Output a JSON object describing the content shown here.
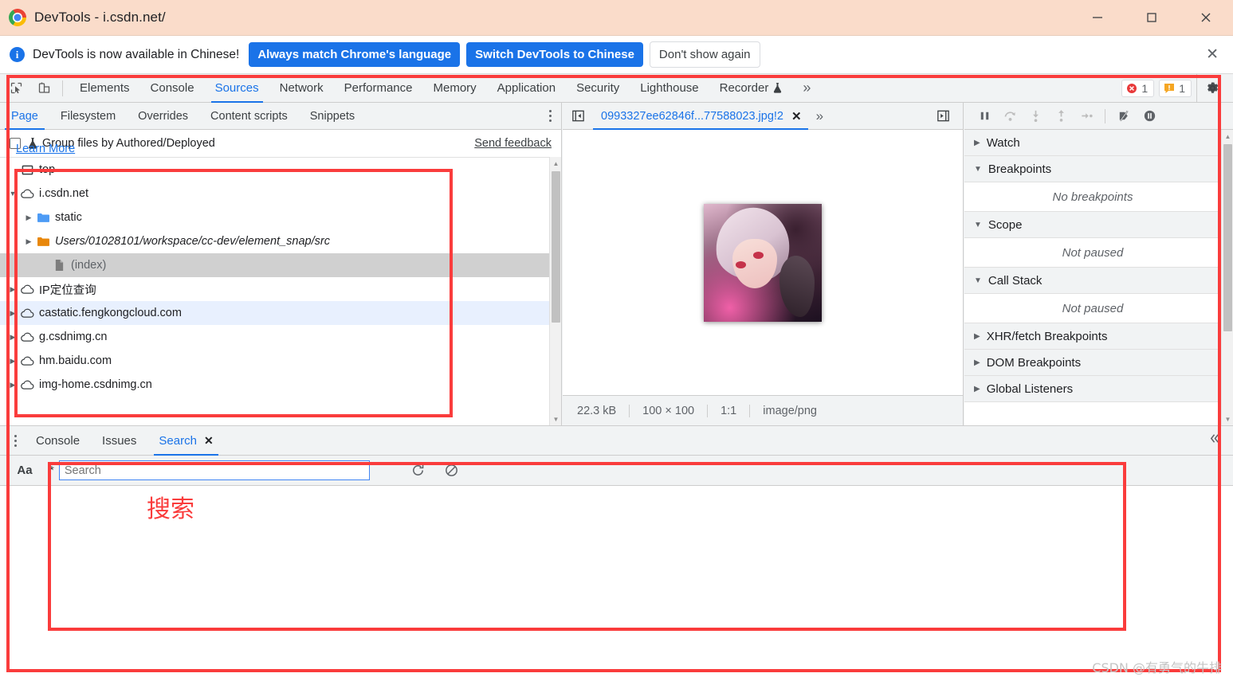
{
  "window": {
    "title": "DevTools - i.csdn.net/",
    "logo_icon": "chrome-logo-icon",
    "minimize_icon": "minimize-icon",
    "maximize_icon": "maximize-icon",
    "close_icon": "close-icon"
  },
  "infobar": {
    "icon": "info-icon",
    "icon_glyph": "i",
    "message": "DevTools is now available in Chinese!",
    "primary_button": "Always match Chrome's language",
    "secondary_button": "Switch DevTools to Chinese",
    "tertiary_button": "Don't show again",
    "close_glyph": "✕",
    "accent_color": "#1a73e8"
  },
  "main_tabs": {
    "inspect_icon": "inspect-element-icon",
    "device_icon": "device-toolbar-icon",
    "items": [
      {
        "label": "Elements",
        "active": false
      },
      {
        "label": "Console",
        "active": false
      },
      {
        "label": "Sources",
        "active": true
      },
      {
        "label": "Network",
        "active": false
      },
      {
        "label": "Performance",
        "active": false
      },
      {
        "label": "Memory",
        "active": false
      },
      {
        "label": "Application",
        "active": false
      },
      {
        "label": "Security",
        "active": false
      },
      {
        "label": "Lighthouse",
        "active": false
      },
      {
        "label": "Recorder",
        "active": false,
        "beaker": true
      }
    ],
    "more_glyph": "»",
    "errors": "1",
    "warnings": "1",
    "error_icon": "error-badge-icon",
    "warning_icon": "warning-badge-icon",
    "settings_icon": "gear-icon"
  },
  "navigator": {
    "tabs": [
      {
        "label": "Page",
        "active": true
      },
      {
        "label": "Filesystem",
        "active": false
      },
      {
        "label": "Overrides",
        "active": false
      },
      {
        "label": "Content scripts",
        "active": false
      },
      {
        "label": "Snippets",
        "active": false
      }
    ],
    "kebab_icon": "more-options-icon",
    "group_checkbox_label": "Group files by Authored/Deployed",
    "group_beaker_icon": "experiment-beaker-icon",
    "send_feedback": "Send feedback",
    "learn_more": "Learn More",
    "tree": [
      {
        "label": "top",
        "icon": "frame-icon",
        "indent": 0,
        "arrow": "none",
        "state": "normal"
      },
      {
        "label": "i.csdn.net",
        "icon": "cloud-icon",
        "indent": 0,
        "arrow": "down",
        "state": "normal"
      },
      {
        "label": "static",
        "icon": "folder-blue-icon",
        "indent": 1,
        "arrow": "right",
        "state": "normal"
      },
      {
        "label": "Users/01028101/workspace/cc-dev/element_snap/src",
        "icon": "folder-orange-icon",
        "indent": 1,
        "arrow": "right",
        "state": "italic"
      },
      {
        "label": "(index)",
        "icon": "document-icon",
        "indent": 2,
        "arrow": "none",
        "state": "selected"
      },
      {
        "label": "IP定位查询",
        "icon": "cloud-icon",
        "indent": 0,
        "arrow": "right",
        "state": "normal"
      },
      {
        "label": "castatic.fengkongcloud.com",
        "icon": "cloud-icon",
        "indent": 0,
        "arrow": "right",
        "state": "highlight"
      },
      {
        "label": "g.csdnimg.cn",
        "icon": "cloud-icon",
        "indent": 0,
        "arrow": "right",
        "state": "normal"
      },
      {
        "label": "hm.baidu.com",
        "icon": "cloud-icon",
        "indent": 0,
        "arrow": "right",
        "state": "normal"
      },
      {
        "label": "img-home.csdnimg.cn",
        "icon": "cloud-icon",
        "indent": 0,
        "arrow": "right",
        "state": "normal"
      }
    ]
  },
  "editor": {
    "prev_icon": "show-navigator-icon",
    "next_icon": "show-debugger-icon",
    "tab_label": "0993327ee62846f...77588023.jpg!2",
    "tab_close_glyph": "✕",
    "more_glyph": "»",
    "preview_alt": "anime-character-image-preview",
    "status": {
      "size": "22.3 kB",
      "dimensions": "100 × 100",
      "ratio": "1:1",
      "mime": "image/png"
    }
  },
  "debugger": {
    "toolbar": [
      {
        "icon": "pause-script-icon",
        "enabled": true
      },
      {
        "icon": "step-over-icon",
        "enabled": false
      },
      {
        "icon": "step-into-icon",
        "enabled": false
      },
      {
        "icon": "step-out-icon",
        "enabled": false
      },
      {
        "icon": "step-icon",
        "enabled": false
      },
      {
        "icon": "deactivate-breakpoints-icon",
        "enabled": true
      },
      {
        "icon": "pause-on-exceptions-icon",
        "enabled": true
      }
    ],
    "sections": [
      {
        "title": "Watch",
        "expanded": false,
        "body": null
      },
      {
        "title": "Breakpoints",
        "expanded": true,
        "body": "No breakpoints"
      },
      {
        "title": "Scope",
        "expanded": true,
        "body": "Not paused"
      },
      {
        "title": "Call Stack",
        "expanded": true,
        "body": "Not paused"
      },
      {
        "title": "XHR/fetch Breakpoints",
        "expanded": false,
        "body": null
      },
      {
        "title": "DOM Breakpoints",
        "expanded": false,
        "body": null
      },
      {
        "title": "Global Listeners",
        "expanded": false,
        "body": null
      }
    ]
  },
  "drawer": {
    "kebab_icon": "drawer-more-options-icon",
    "tabs": [
      {
        "label": "Console",
        "active": false,
        "closable": false
      },
      {
        "label": "Issues",
        "active": false,
        "closable": false
      },
      {
        "label": "Search",
        "active": true,
        "closable": true
      }
    ],
    "close_glyph": "✕",
    "collapse_icon": "collapse-drawer-icon",
    "search": {
      "match_case_label": "Aa",
      "regex_label": "*",
      "placeholder": "Search",
      "value": "",
      "refresh_icon": "refresh-icon",
      "clear_icon": "clear-icon"
    }
  },
  "annotations": {
    "label_search": "搜索",
    "color": "#fa3c3c"
  },
  "watermark": "CSDN @有勇气的牛排"
}
